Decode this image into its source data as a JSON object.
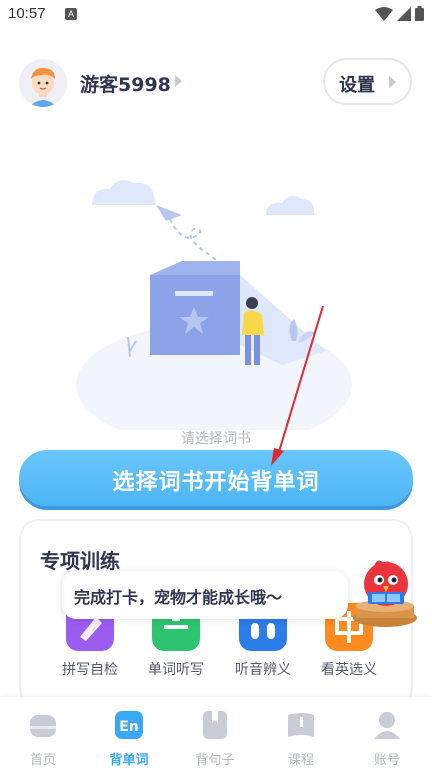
{
  "status_bar": {
    "time": "10:57",
    "notif_icon": "A"
  },
  "header": {
    "username": "游客5998",
    "settings_label": "设置"
  },
  "empty_state": {
    "hint": "请选择词书"
  },
  "cta": {
    "label": "选择词书开始背单词"
  },
  "training": {
    "title": "专项训练",
    "items": [
      {
        "label": "拼写自检",
        "color": "#9b5cf0",
        "icon": "pencil-spell-icon"
      },
      {
        "label": "单词听写",
        "color": "#2fc46f",
        "icon": "dictation-icon"
      },
      {
        "label": "听音辨义",
        "color": "#2b7de9",
        "icon": "listen-icon"
      },
      {
        "label": "看英选义",
        "color": "#ff8a1f",
        "icon": "chinese-char-icon"
      }
    ],
    "tooltip": "完成打卡，宠物才能成长哦～"
  },
  "bottom_nav": {
    "items": [
      {
        "label": "首页",
        "icon": "home-icon",
        "active": false
      },
      {
        "label": "背单词",
        "icon": "en-icon",
        "active": true
      },
      {
        "label": "背句子",
        "icon": "bookmark-book-icon",
        "active": false
      },
      {
        "label": "课程",
        "icon": "course-icon",
        "active": false
      },
      {
        "label": "账号",
        "icon": "account-icon",
        "active": false
      }
    ],
    "active_color": "#3aa8f2",
    "inactive_color": "#b5b9c4"
  },
  "colors": {
    "accent": "#4db5f5",
    "arrow": "#e0282e"
  }
}
